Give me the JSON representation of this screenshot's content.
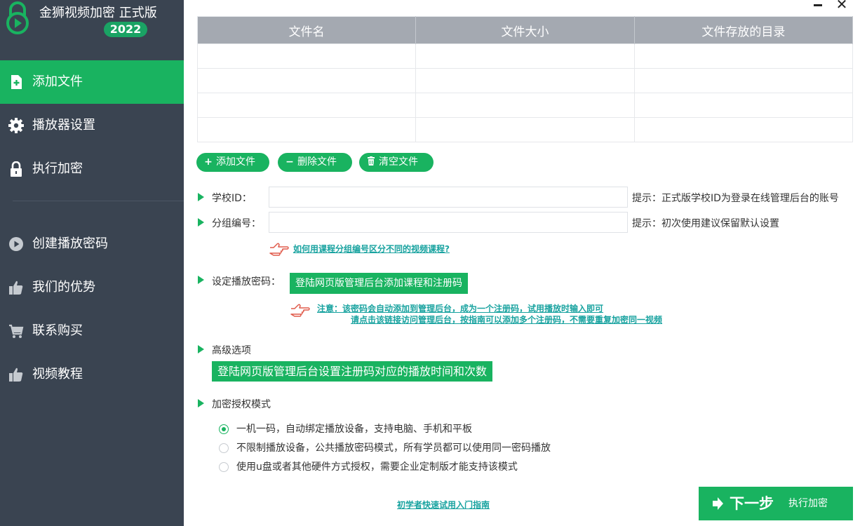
{
  "app": {
    "title": "金狮视频加密 正式版",
    "year_badge": "2022"
  },
  "sidebar": {
    "items": [
      {
        "label": "添加文件",
        "icon": "add-file-icon",
        "active": true
      },
      {
        "label": "播放器设置",
        "icon": "gear-icon",
        "active": false
      },
      {
        "label": "执行加密",
        "icon": "lock-icon",
        "active": false
      },
      {
        "label": "创建播放密码",
        "icon": "play-circle-icon",
        "active": false
      },
      {
        "label": "我们的优势",
        "icon": "thumbs-up-icon",
        "active": false
      },
      {
        "label": "联系购买",
        "icon": "cart-icon",
        "active": false
      },
      {
        "label": "视频教程",
        "icon": "thumbs-up-icon",
        "active": false
      }
    ]
  },
  "window": {
    "close_glyph": "✕"
  },
  "file_table": {
    "columns": [
      "文件名",
      "文件大小",
      "文件存放的目录"
    ],
    "rows": [
      [
        "",
        "",
        ""
      ],
      [
        "",
        "",
        ""
      ],
      [
        "",
        "",
        ""
      ],
      [
        "",
        "",
        ""
      ]
    ]
  },
  "file_buttons": {
    "add": {
      "label": "添加文件",
      "icon": "+"
    },
    "delete": {
      "label": "删除文件",
      "icon": "−"
    },
    "clear": {
      "label": "清空文件",
      "icon": "🗑"
    }
  },
  "form": {
    "school_id": {
      "label": "学校ID：",
      "value": "",
      "hint": "提示：正式版学校ID为登录在线管理后台的账号"
    },
    "group_no": {
      "label": "分组编号：",
      "value": "",
      "hint": "提示：初次使用建议保留默认设置"
    },
    "group_help_link": "如何用课程分组编号区分不同的视频课程?",
    "password": {
      "label": "设定播放密码：",
      "button": "登陆网页版管理后台添加课程和注册码",
      "note_line1": "注意：该密码会自动添加到管理后台，成为一个注册码，试用播放时输入即可",
      "note_line2": "请点击该链接访问管理后台，按指南可以添加多个注册码，不需要重复加密同一视频"
    },
    "advanced": {
      "label": "高级选项",
      "button": "登陆网页版管理后台设置注册码对应的播放时间和次数"
    },
    "license_mode": {
      "label": "加密授权模式",
      "options": [
        {
          "label": "一机一码，自动绑定播放设备，支持电脑、手机和平板",
          "checked": true
        },
        {
          "label": "不限制播放设备，公共播放密码模式，所有学员都可以使用同一密码播放",
          "checked": false
        },
        {
          "label": "使用u盘或者其他硬件方式授权，需要企业定制版才能支持该模式",
          "checked": false
        }
      ]
    }
  },
  "footer": {
    "guide_link": "初学者快速试用入门指南",
    "next_button": {
      "label": "下一步",
      "sub": "执行加密"
    }
  },
  "colors": {
    "accent": "#19b360",
    "sidebar_bg": "#3a4451",
    "table_header_bg": "#a4a9b1",
    "link": "#19a3a0",
    "hand_icon": "#e05a4a"
  }
}
